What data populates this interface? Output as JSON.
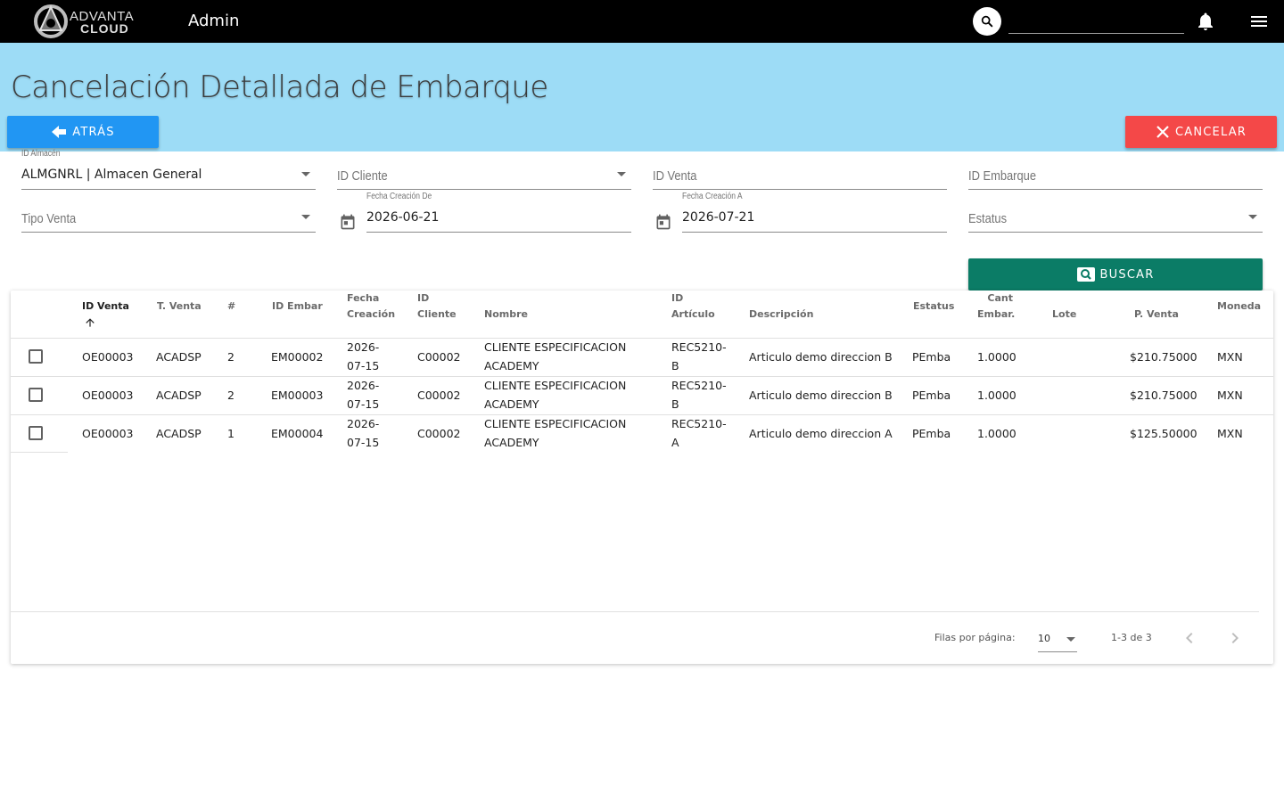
{
  "header": {
    "brand_top": "ADVANTA",
    "brand_bottom": "CLOUD",
    "app_title": "Admin",
    "search_value": ""
  },
  "page": {
    "title": "Cancelación Detallada de Embarque",
    "back_label": "ATRÁS",
    "cancel_label": "CANCELAR",
    "search_label": "BUSCAR"
  },
  "filters": {
    "almacen_label": "ID Almacén",
    "almacen_value": "ALMGNRL | Almacen General",
    "cliente_placeholder": "ID Cliente",
    "venta_placeholder": "ID Venta",
    "embarque_placeholder": "ID Embarque",
    "tipo_venta_placeholder": "Tipo Venta",
    "fecha_de_label": "Fecha Creación De",
    "fecha_de_value": "2026-06-21",
    "fecha_a_label": "Fecha Creación A",
    "fecha_a_value": "2026-07-21",
    "estatus_placeholder": "Estatus"
  },
  "table": {
    "headers": {
      "id_venta": "ID Venta",
      "t_venta": "T. Venta",
      "num": "#",
      "id_embar": "ID Embar",
      "fecha_1": "Fecha",
      "fecha_2": "Creación",
      "cliente_1": "ID",
      "cliente_2": "Cliente",
      "nombre": "Nombre",
      "articulo_1": "ID",
      "articulo_2": "Artículo",
      "descripcion": "Descripción",
      "estatus": "Estatus",
      "cant_1": "Cant",
      "cant_2": "Embar.",
      "lote": "Lote",
      "p_venta": "P. Venta",
      "moneda": "Moneda"
    },
    "rows": [
      {
        "id_venta": "OE00003",
        "t_venta": "ACADSP",
        "num": "2",
        "id_embar": "EM00002",
        "fecha_1": "2026-",
        "fecha_2": "07-15",
        "cliente": "C00002",
        "nombre_1": "CLIENTE ESPECIFICACION",
        "nombre_2": "ACADEMY",
        "articulo_1": "REC5210-",
        "articulo_2": "B",
        "descripcion": "Articulo demo direccion B",
        "estatus": "PEmba",
        "cant": "1.0000",
        "lote": "",
        "p_venta": "$210.75000",
        "moneda": "MXN"
      },
      {
        "id_venta": "OE00003",
        "t_venta": "ACADSP",
        "num": "2",
        "id_embar": "EM00003",
        "fecha_1": "2026-",
        "fecha_2": "07-15",
        "cliente": "C00002",
        "nombre_1": "CLIENTE ESPECIFICACION",
        "nombre_2": "ACADEMY",
        "articulo_1": "REC5210-",
        "articulo_2": "B",
        "descripcion": "Articulo demo direccion B",
        "estatus": "PEmba",
        "cant": "1.0000",
        "lote": "",
        "p_venta": "$210.75000",
        "moneda": "MXN"
      },
      {
        "id_venta": "OE00003",
        "t_venta": "ACADSP",
        "num": "1",
        "id_embar": "EM00004",
        "fecha_1": "2026-",
        "fecha_2": "07-15",
        "cliente": "C00002",
        "nombre_1": "CLIENTE ESPECIFICACION",
        "nombre_2": "ACADEMY",
        "articulo_1": "REC5210-",
        "articulo_2": "A",
        "descripcion": "Articulo demo direccion A",
        "estatus": "PEmba",
        "cant": "1.0000",
        "lote": "",
        "p_venta": "$125.50000",
        "moneda": "MXN"
      }
    ],
    "footer": {
      "rows_per_page_label": "Filas por página:",
      "rows_per_page_value": "10",
      "range_text": "1-3 de 3"
    }
  },
  "icons": {
    "search": "search-icon",
    "bell": "bell-icon",
    "menu": "menu-icon",
    "back": "arrow-left-icon",
    "close": "close-icon",
    "calendar": "calendar-icon",
    "sort": "arrow-up-icon",
    "prev": "chevron-left-icon",
    "next": "chevron-right-icon"
  },
  "colors": {
    "topbar": "#000000",
    "band": "#9ddcf6",
    "back_button": "#2196f3",
    "cancel_button": "#f44848",
    "search_button": "#0b7c66"
  }
}
